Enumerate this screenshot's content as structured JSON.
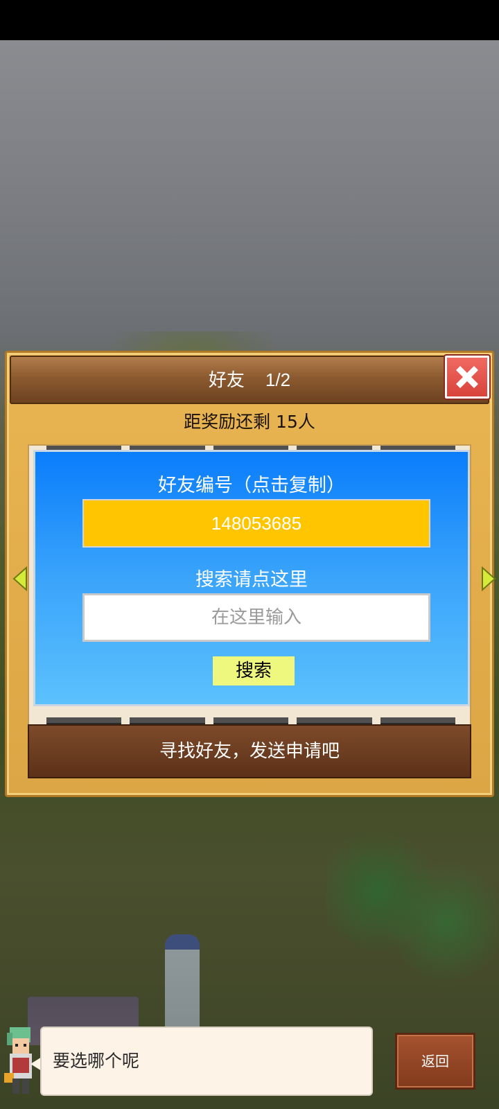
{
  "dialog": {
    "title": "好友",
    "page": "1/2",
    "reward_text": "距奖励还剩 15人",
    "friend_panel": {
      "id_label": "好友编号（点击复制）",
      "id_value": "148053685",
      "search_label": "搜索请点这里",
      "search_placeholder": "在这里输入",
      "search_button": "搜索"
    },
    "find_friends_text": "寻找好友，发送申请吧"
  },
  "bottom": {
    "speech_text": "要选哪个呢",
    "back_label": "返回"
  },
  "colors": {
    "panel_blue": "#0a7dfb",
    "id_box_yellow": "#ffc600",
    "search_button_yellow": "#eef77e",
    "close_red": "#e4524a",
    "header_brown": "#8c5a30"
  },
  "icons": [
    "close-icon",
    "arrow-left-icon",
    "arrow-right-icon",
    "avatar-icon"
  ]
}
